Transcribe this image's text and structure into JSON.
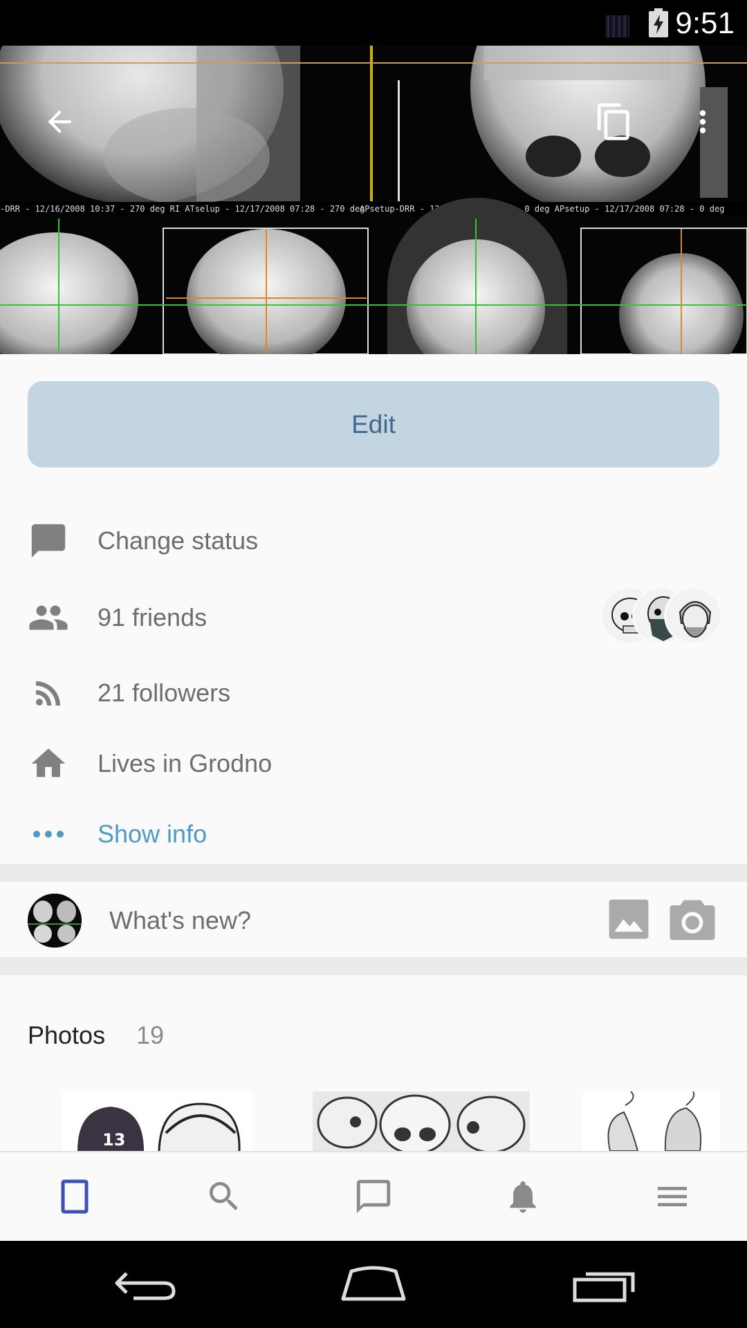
{
  "status_bar": {
    "time": "9:51"
  },
  "profile": {
    "edit_label": "Edit",
    "rows": {
      "status": "Change status",
      "friends": "91 friends",
      "followers": "21 followers",
      "location": "Lives in Grodno",
      "show_info": "Show info"
    }
  },
  "composer": {
    "placeholder": "What's new?"
  },
  "photos": {
    "title": "Photos",
    "count": "19"
  },
  "colors": {
    "accent": "#4d9bc2",
    "edit_bg": "#c3d5e0",
    "active_nav": "#3f51b5",
    "icon_gray": "#8a8a8a"
  },
  "icons": {
    "cover": [
      "back-arrow-icon",
      "copy-icon",
      "more-vert-icon"
    ],
    "rows": [
      "chat-bubble-icon",
      "people-icon",
      "rss-icon",
      "home-icon",
      "more-horiz-icon"
    ],
    "composer": [
      "image-icon",
      "camera-icon"
    ],
    "bottom_nav": [
      "profile-icon",
      "search-icon",
      "messages-icon",
      "notifications-icon",
      "menu-icon"
    ],
    "system_nav": [
      "back-icon",
      "home-icon",
      "recents-icon"
    ]
  }
}
